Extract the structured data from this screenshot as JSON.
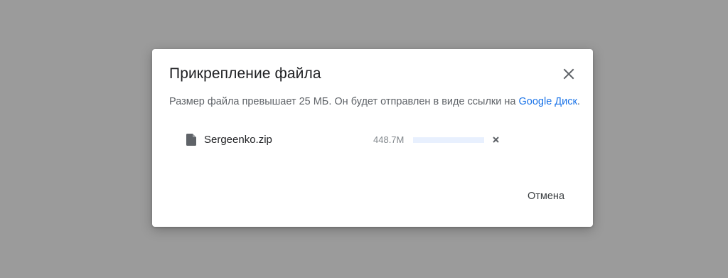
{
  "dialog": {
    "title": "Прикрепление файла",
    "message_text": "Размер файла превышает 25 МБ. Он будет отправлен в виде ссылки на ",
    "drive_link": "Google Диск",
    "message_end": ".",
    "cancel_label": "Отмена"
  },
  "attachment": {
    "file_name": "Sergeenko.zip",
    "file_size": "448.7M",
    "upload_progress": 0
  },
  "icons": {
    "close": "close-icon",
    "file": "file-icon",
    "remove": "remove-icon"
  },
  "colors": {
    "backdrop": "#9b9b9b",
    "link": "#1a73e8",
    "progress_track": "#e8f0fe"
  }
}
